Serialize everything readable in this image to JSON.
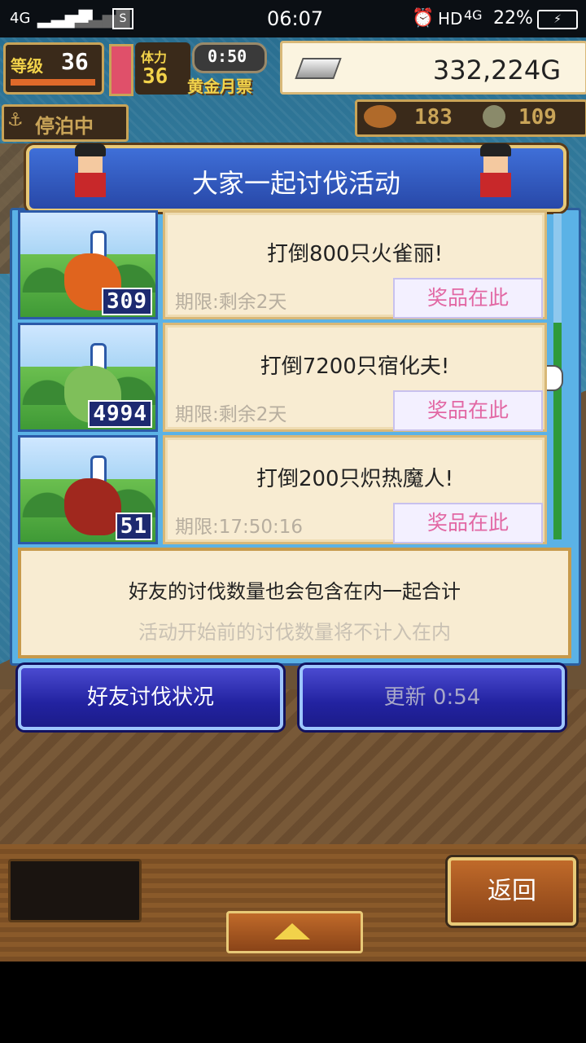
{
  "status_bar": {
    "network": "4G",
    "time": "06:07",
    "hd": "HD",
    "network2": "4G",
    "battery": "22%"
  },
  "hud": {
    "level_label": "等级",
    "level_value": "36",
    "stamina_label": "体力",
    "stamina_value": "36",
    "timer": "0:50",
    "pass_label": "黄金月票",
    "gold": "332,224G",
    "status_label": "停泊中",
    "resource1": "183",
    "resource2": "109"
  },
  "dialog": {
    "title": "大家一起讨伐活动",
    "events": [
      {
        "kill_count": "309",
        "title": "打倒800只火雀丽!",
        "limit": "期限:剩余2天",
        "prize": "奖品在此",
        "monster_color": "#e0641e"
      },
      {
        "kill_count": "4994",
        "title": "打倒7200只宿化夫!",
        "limit": "期限:剩余2天",
        "prize": "奖品在此",
        "monster_color": "#7fbf5a"
      },
      {
        "kill_count": "51",
        "title": "打倒200只炽热魔人!",
        "limit": "期限:17:50:16",
        "prize": "奖品在此",
        "monster_color": "#a0281e"
      }
    ],
    "note_line1": "好友的讨伐数量也会包含在内一起合计",
    "note_line2": "活动开始前的讨伐数量将不计入在内",
    "friend_button": "好友讨伐状况",
    "refresh_button": "更新 0:54"
  },
  "footer": {
    "back_button": "返回"
  },
  "colors": {
    "dialog_bg": "#5bb2e6",
    "prize_text": "#e268a4",
    "button_blue": "#2222a0"
  }
}
